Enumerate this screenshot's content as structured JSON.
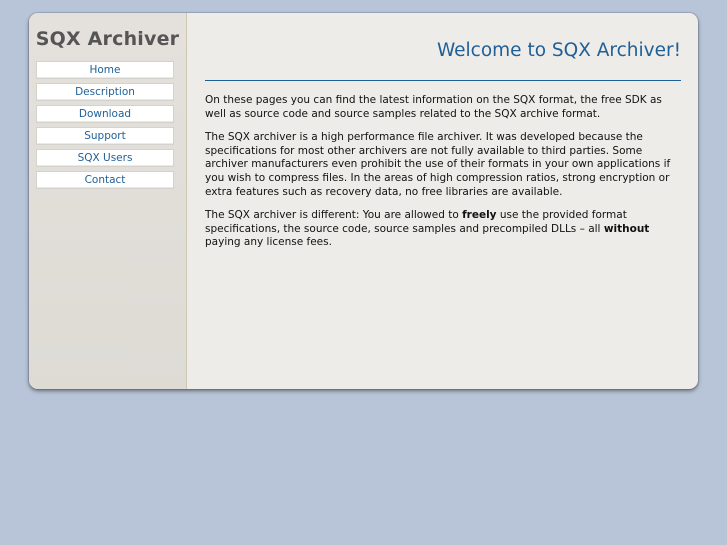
{
  "sidebar": {
    "title": "SQX Archiver",
    "nav": [
      {
        "label": "Home"
      },
      {
        "label": "Description"
      },
      {
        "label": "Download"
      },
      {
        "label": "Support"
      },
      {
        "label": "SQX Users"
      },
      {
        "label": "Contact"
      }
    ]
  },
  "main": {
    "heading": "Welcome to SQX Archiver!",
    "paragraph1": "On these pages you can find the latest information on the SQX format, the free SDK as well as source code and source samples related to the SQX archive format.",
    "paragraph2": "The SQX archiver is a high performance file archiver. It was developed because the specifications for most other archivers are not fully available to third parties. Some archiver manufacturers even prohibit the use of their formats in your own applications if you wish to compress files. In the areas of high compression ratios, strong encryption or extra features such as recovery data, no free libraries are available.",
    "paragraph3": {
      "part1": "The SQX archiver is different: You are allowed to ",
      "bold1": "freely",
      "part2": " use the provided format specifications, the source code, source samples and precompiled DLLs – all ",
      "bold2": "without",
      "part3": " paying any license fees."
    }
  },
  "colors": {
    "page_background": "#b8c5d9",
    "content_background": "#eeece8",
    "sidebar_background": "#e1ded9",
    "accent": "#1f5f97",
    "title_gray": "#555555"
  }
}
